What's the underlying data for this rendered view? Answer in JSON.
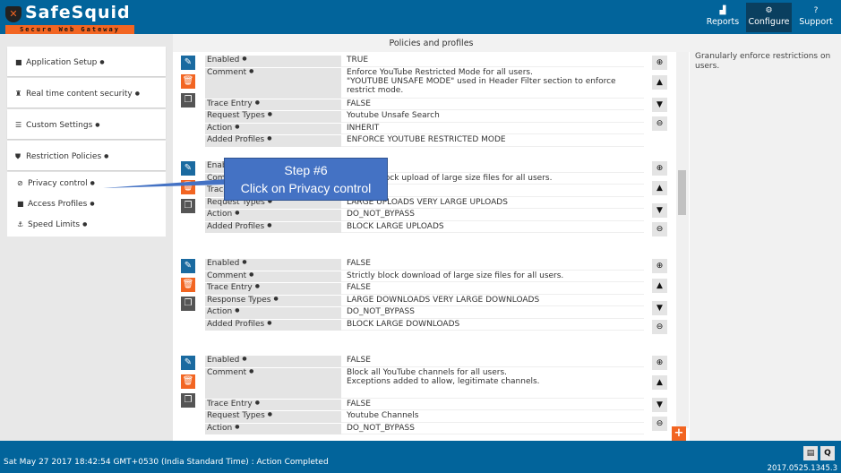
{
  "header": {
    "brand": "SafeSquid",
    "tagline": "Secure Web Gateway",
    "nav": [
      {
        "label": "Reports",
        "icon": "chart-icon"
      },
      {
        "label": "Configure",
        "icon": "gears-icon",
        "active": true
      },
      {
        "label": "Support",
        "icon": "question-icon"
      }
    ]
  },
  "sidebar": {
    "sections": [
      {
        "label": "Application Setup",
        "icon": "briefcase-icon"
      },
      {
        "label": "Real time content security",
        "icon": "castle-icon"
      },
      {
        "label": "Custom Settings",
        "icon": "sliders-icon"
      },
      {
        "label": "Restriction Policies",
        "icon": "shield-icon"
      }
    ],
    "items": [
      {
        "label": "Privacy control",
        "icon": "ban-icon"
      },
      {
        "label": "Access Profiles",
        "icon": "briefcase-icon"
      },
      {
        "label": "Speed Limits",
        "icon": "speed-icon"
      }
    ]
  },
  "main": {
    "title": "Policies and profiles",
    "policies": [
      {
        "rows": [
          [
            "Enabled",
            "TRUE"
          ],
          [
            "Comment",
            "Enforce YouTube Restricted Mode for all users.\n\"YOUTUBE UNSAFE MODE\" used in Header Filter section to enforce restrict mode."
          ],
          [
            "Trace Entry",
            "FALSE"
          ],
          [
            "Request Types",
            "Youtube Unsafe Search"
          ],
          [
            "Action",
            "INHERIT"
          ],
          [
            "Added Profiles",
            "ENFORCE YOUTUBE RESTRICTED MODE"
          ]
        ]
      },
      {
        "rows": [
          [
            "Enabled",
            ""
          ],
          [
            "Comment",
            "Strictly block upload of large size files for all users."
          ],
          [
            "Trace Entry",
            ""
          ],
          [
            "Request Types",
            "LARGE UPLOADS  VERY LARGE UPLOADS"
          ],
          [
            "Action",
            "DO_NOT_BYPASS"
          ],
          [
            "Added Profiles",
            "BLOCK LARGE UPLOADS"
          ]
        ]
      },
      {
        "rows": [
          [
            "Enabled",
            "FALSE"
          ],
          [
            "Comment",
            "Strictly block download of large size files for all users."
          ],
          [
            "Trace Entry",
            "FALSE"
          ],
          [
            "Response Types",
            "LARGE DOWNLOADS  VERY LARGE DOWNLOADS"
          ],
          [
            "Action",
            "DO_NOT_BYPASS"
          ],
          [
            "Added Profiles",
            "BLOCK LARGE DOWNLOADS"
          ]
        ]
      },
      {
        "rows": [
          [
            "Enabled",
            "FALSE"
          ],
          [
            "Comment",
            "Block all YouTube channels for all users.\nExceptions added to allow, legitimate channels."
          ],
          [
            "Trace Entry",
            "FALSE"
          ],
          [
            "Request Types",
            "Youtube Channels"
          ],
          [
            "Action",
            "DO_NOT_BYPASS"
          ]
        ]
      }
    ]
  },
  "right_panel": {
    "text": "Granularly enforce restrictions on users."
  },
  "callout": {
    "line1": "Step #6",
    "line2": "Click on Privacy control"
  },
  "footer": {
    "status": "Sat May 27 2017 18:42:54 GMT+0530 (India Standard Time) : Action Completed",
    "version": "2017.0525.1345.3"
  },
  "colors": {
    "header": "#02649b",
    "accent": "#f26522",
    "callout": "#4472c4"
  }
}
